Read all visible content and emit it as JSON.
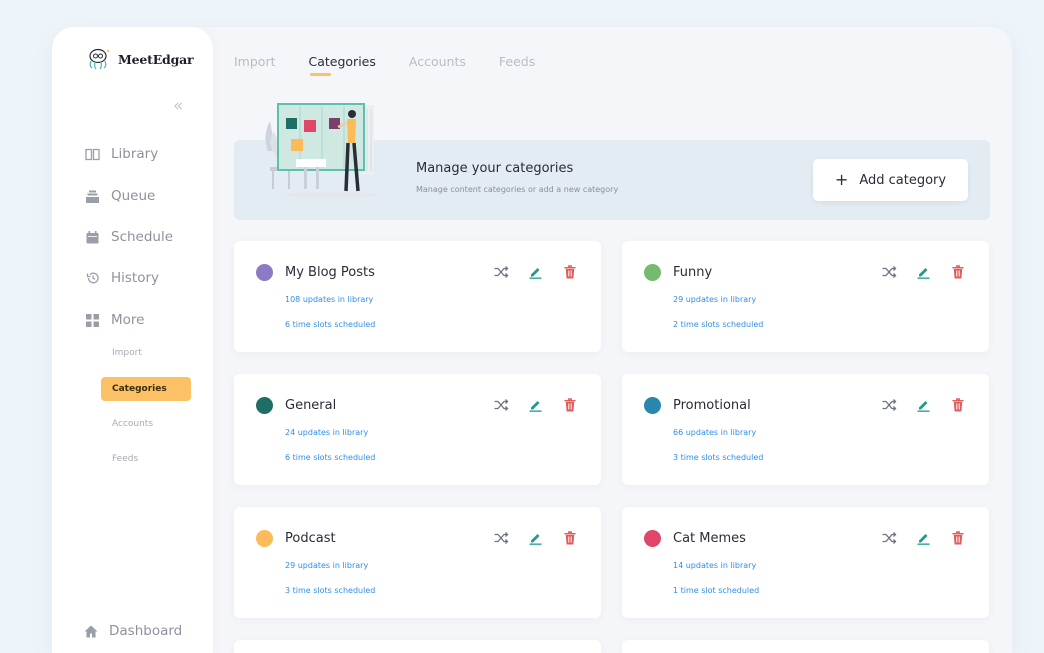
{
  "app": {
    "brand": "MeetEdgar",
    "collapse_glyph": "«"
  },
  "sidebar": {
    "items": [
      {
        "label": "Library",
        "icon": "book-icon"
      },
      {
        "label": "Queue",
        "icon": "stack-icon"
      },
      {
        "label": "Schedule",
        "icon": "calendar-icon"
      },
      {
        "label": "History",
        "icon": "history-icon"
      },
      {
        "label": "More",
        "icon": "grid-icon"
      }
    ],
    "sub_items": [
      "Import",
      "Categories",
      "Accounts",
      "Feeds"
    ],
    "active_sub": "Categories",
    "footer": {
      "label": "Dashboard",
      "icon": "home-icon"
    }
  },
  "tabs": [
    {
      "label": "Import",
      "active": false
    },
    {
      "label": "Categories",
      "active": true
    },
    {
      "label": "Accounts",
      "active": false
    },
    {
      "label": "Feeds",
      "active": false
    }
  ],
  "banner": {
    "title": "Manage your categories",
    "subtitle": "Manage content categories or add a new category",
    "add_button": "Add category",
    "add_icon": "+"
  },
  "categories": [
    {
      "name": "My Blog Posts",
      "updates": "108 updates in library",
      "slots": "6 time slots scheduled",
      "color": "#8b7bc4"
    },
    {
      "name": "Funny",
      "updates": "29 updates in library",
      "slots": "2 time slots scheduled",
      "color": "#74bb6f"
    },
    {
      "name": "General",
      "updates": "24 updates in library",
      "slots": "6 time slots scheduled",
      "color": "#1f6e66"
    },
    {
      "name": "Promotional",
      "updates": "66 updates in library",
      "slots": "3 time slots scheduled",
      "color": "#2a86ab"
    },
    {
      "name": "Podcast",
      "updates": "29 updates in library",
      "slots": "3 time slots scheduled",
      "color": "#fbbb59"
    },
    {
      "name": "Cat Memes",
      "updates": "14 updates in library",
      "slots": "1 time slot scheduled",
      "color": "#e0456a"
    }
  ],
  "colors": {
    "accent": "#fbc164",
    "link": "#2f8ee8",
    "edit": "#1f9c8c",
    "delete": "#e05c5c",
    "shuffle": "#6e7380"
  }
}
